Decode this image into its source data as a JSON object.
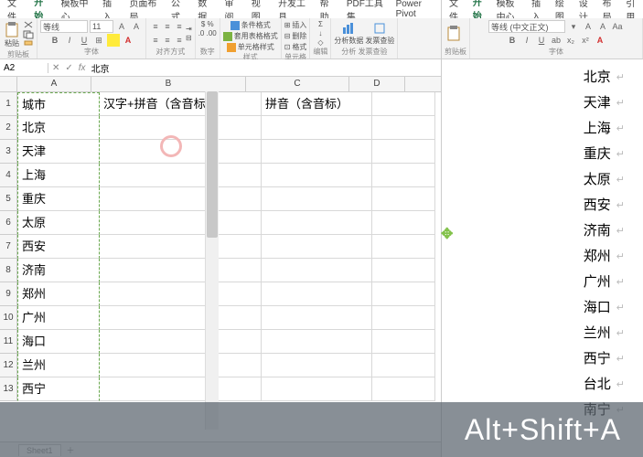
{
  "excel": {
    "tabs": [
      "文件",
      "开始",
      "模板中心",
      "插入",
      "页面布局",
      "公式",
      "数据",
      "审阅",
      "视图",
      "开发工具",
      "帮助",
      "PDF工具集",
      "Power Pivot"
    ],
    "active_tab": "开始",
    "ribbon": {
      "clipboard": {
        "paste": "粘贴",
        "label": "剪贴板"
      },
      "font": {
        "name": "等线",
        "size": "11",
        "label": "字体"
      },
      "align": {
        "label": "对齐方式"
      },
      "number": {
        "label": "数字"
      },
      "styles": {
        "cond": "条件格式",
        "table": "套用表格格式",
        "cell": "单元格样式",
        "label": "样式"
      },
      "cells": {
        "insert": "插入",
        "delete": "删除",
        "format": "格式",
        "label": "单元格"
      },
      "editing": {
        "label": "编辑"
      },
      "analysis": {
        "a": "分析数据",
        "b": "发票查验",
        "label_a": "分析",
        "label_b": "发票查验"
      }
    },
    "namebox": "A2",
    "formula": "北京",
    "columns": [
      "A",
      "B",
      "C",
      "D"
    ],
    "headers": {
      "A": "城市",
      "B": "汉字+拼音（含音标）",
      "C": "拼音（含音标）"
    },
    "rows": [
      "北京",
      "天津",
      "上海",
      "重庆",
      "太原",
      "西安",
      "济南",
      "郑州",
      "广州",
      "海口",
      "兰州",
      "西宁"
    ],
    "sheet": "Sheet1"
  },
  "word": {
    "tabs": [
      "文件",
      "开始",
      "模板中心",
      "插入",
      "绘图",
      "设计",
      "布局",
      "引用"
    ],
    "active_tab": "开始",
    "ribbon": {
      "font": "等线 (中文正文)",
      "label": "字体"
    },
    "lines": [
      "北京",
      "天津",
      "上海",
      "重庆",
      "太原",
      "西安",
      "济南",
      "郑州",
      "广州",
      "海口",
      "兰州",
      "西宁",
      "台北",
      "南宁"
    ]
  },
  "overlay": {
    "text": "Alt+Shift+A"
  },
  "icons": {
    "fx": "fx",
    "check": "✓",
    "x": "✕",
    "plus": "＋",
    "arrow": "↩"
  }
}
